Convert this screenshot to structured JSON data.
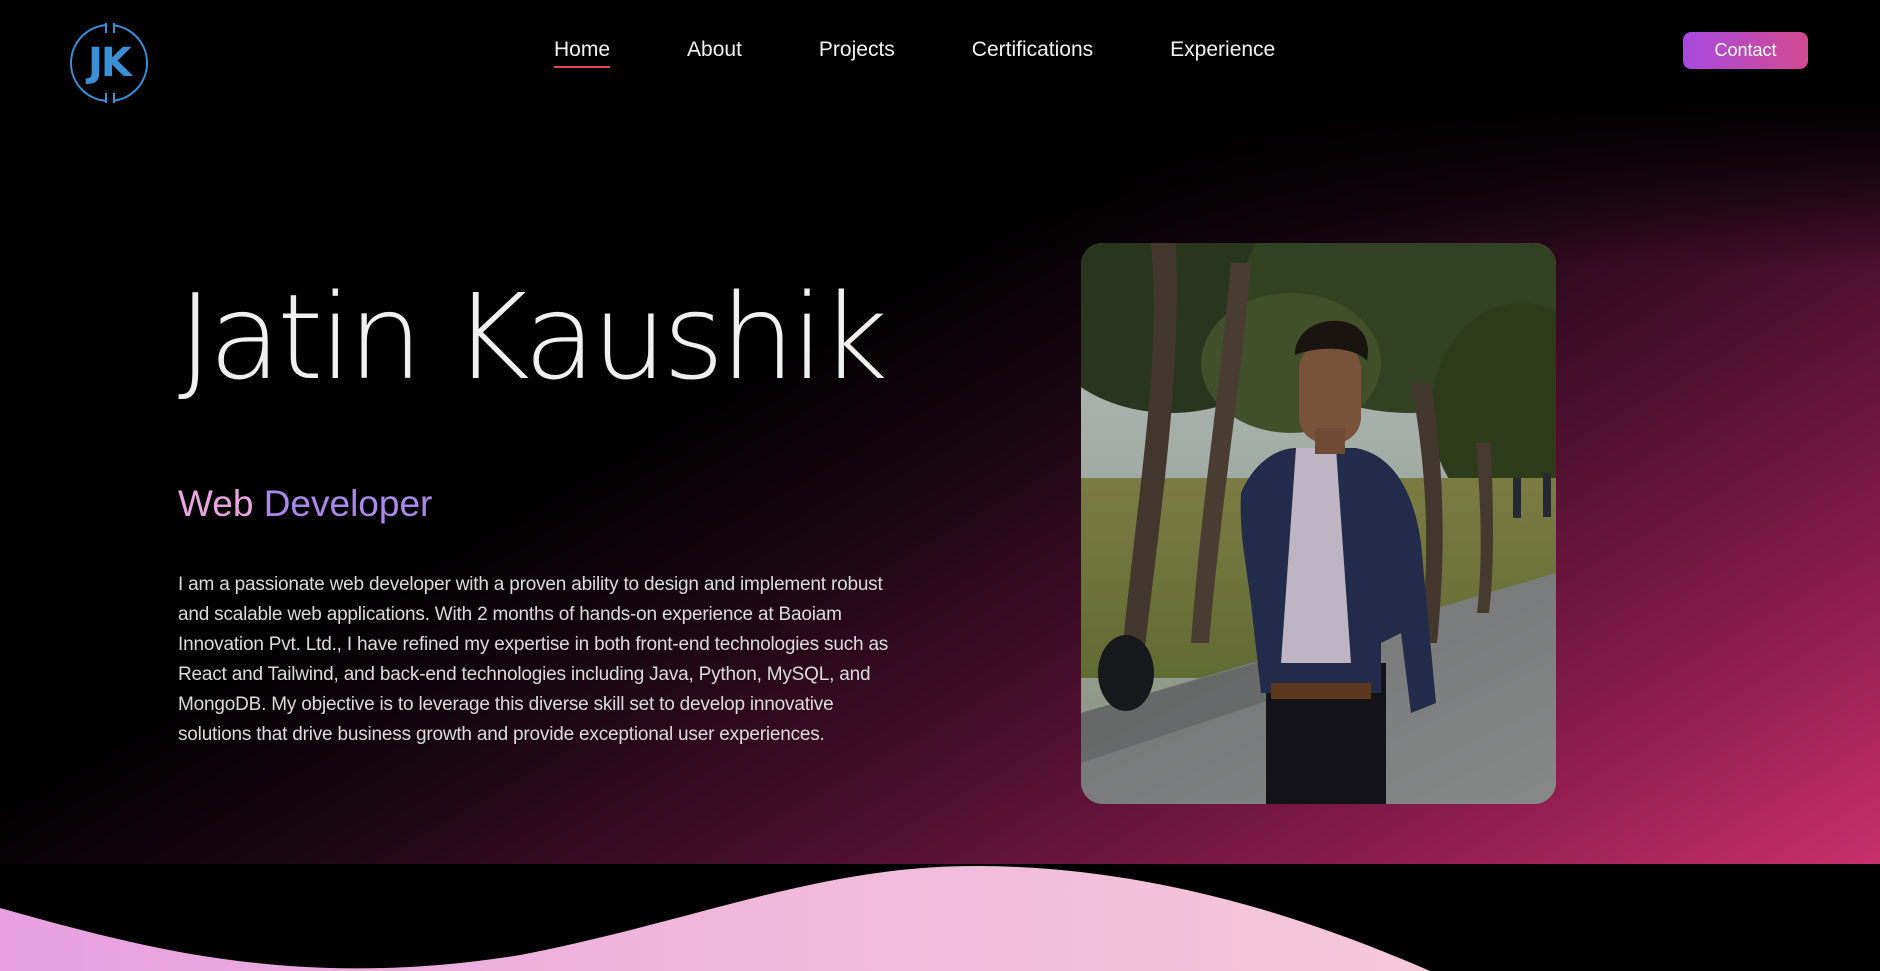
{
  "header": {
    "logo_text": "JK",
    "nav": [
      {
        "label": "Home",
        "active": true
      },
      {
        "label": "About",
        "active": false
      },
      {
        "label": "Projects",
        "active": false
      },
      {
        "label": "Certifications",
        "active": false
      },
      {
        "label": "Experience",
        "active": false
      }
    ],
    "contact_label": "Contact"
  },
  "hero": {
    "name": "Jatin Kaushik",
    "role_part1": "Web",
    "role_part2": "Developer",
    "description": "I am a passionate web developer with a proven ability to design and implement robust and scalable web applications. With 2 months of hands-on experience at Baoiam Innovation Pvt. Ltd., I have refined my expertise in both front-end technologies such as React and Tailwind, and back-end technologies including Java, Python, MySQL, and MongoDB. My objective is to leverage this diverse skill set to develop innovative solutions that drive business growth and provide exceptional user experiences."
  },
  "colors": {
    "logo_accent": "#3b8fd6",
    "nav_underline": "#e0475b",
    "contact_gradient_start": "#a84ae0",
    "contact_gradient_end": "#d24a8e",
    "hero_gradient_end": "#c8306a",
    "wave_start": "#e8a0e0",
    "wave_end": "#f5c8d8"
  }
}
